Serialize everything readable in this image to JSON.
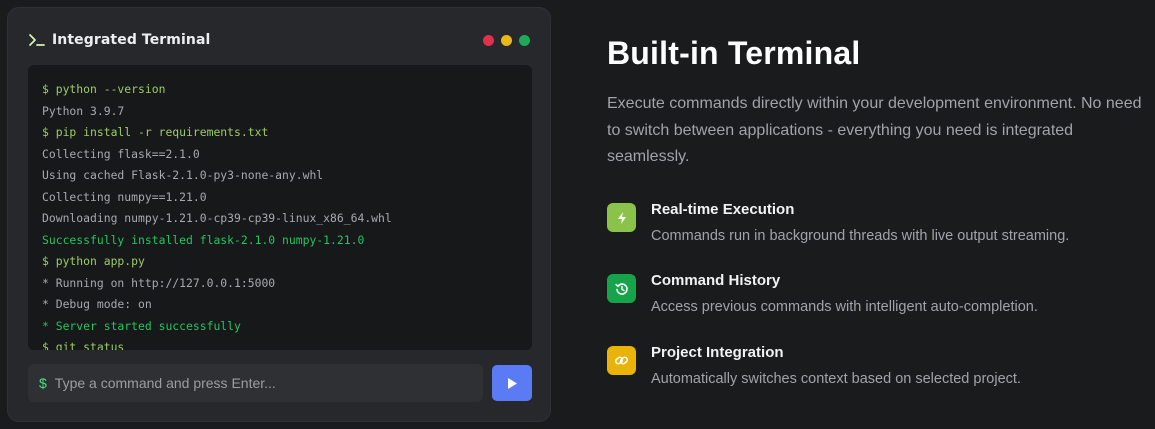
{
  "terminal": {
    "title": "Integrated Terminal",
    "window_dots": [
      "#e0304d",
      "#e8b91b",
      "#1faa5a"
    ],
    "lines": [
      {
        "text": "$ python --version",
        "kind": "command"
      },
      {
        "text": "Python 3.9.7",
        "kind": "output"
      },
      {
        "text": "$ pip install -r requirements.txt",
        "kind": "command"
      },
      {
        "text": "Collecting flask==2.1.0",
        "kind": "output"
      },
      {
        "text": "Using cached Flask-2.1.0-py3-none-any.whl",
        "kind": "output"
      },
      {
        "text": "Collecting numpy==1.21.0",
        "kind": "output"
      },
      {
        "text": "Downloading numpy-1.21.0-cp39-cp39-linux_x86_64.whl",
        "kind": "output"
      },
      {
        "text": "Successfully installed flask-2.1.0 numpy-1.21.0",
        "kind": "success"
      },
      {
        "text": "$ python app.py",
        "kind": "command"
      },
      {
        "text": "* Running on http://127.0.0.1:5000",
        "kind": "output"
      },
      {
        "text": "* Debug mode: on",
        "kind": "output"
      },
      {
        "text": "* Server started successfully",
        "kind": "success"
      },
      {
        "text": "$ git status",
        "kind": "command"
      }
    ],
    "input": {
      "prefix": "$",
      "value": "",
      "placeholder": "Type a command and press Enter..."
    },
    "send_icon": "play-icon",
    "colors": {
      "command": "#9ccc65",
      "output": "#a6a9ad",
      "success": "#22c55e",
      "send_button": "#5b7bf5"
    }
  },
  "info": {
    "title": "Built-in Terminal",
    "description": "Execute commands directly within your development environment. No need to switch between applications - everything you need is integrated seamlessly.",
    "features": [
      {
        "icon": "lightning-icon",
        "icon_color": "#8bc34a",
        "title": "Real-time Execution",
        "description": "Commands run in background threads with live output streaming."
      },
      {
        "icon": "history-icon",
        "icon_color": "#16a34a",
        "title": "Command History",
        "description": "Access previous commands with intelligent auto-completion."
      },
      {
        "icon": "link-icon",
        "icon_color": "#eab308",
        "title": "Project Integration",
        "description": "Automatically switches context based on selected project."
      }
    ]
  }
}
